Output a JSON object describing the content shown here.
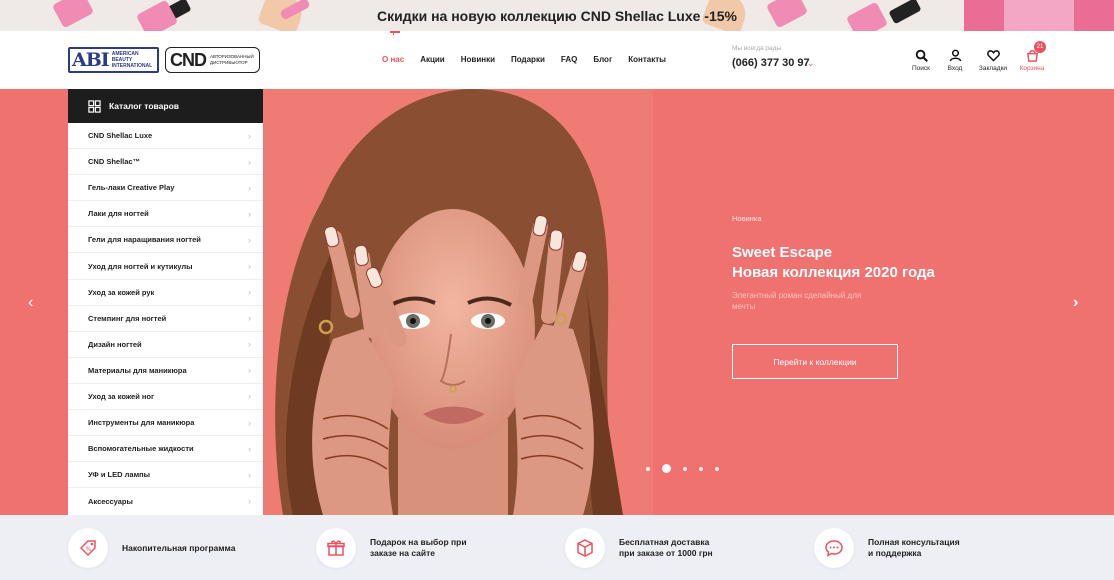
{
  "promo": {
    "text": "Скидки на новую коллекцию CND Shellac Luxe -15%"
  },
  "header": {
    "logo_abi": {
      "mark": "ABI",
      "words": "American Beauty International"
    },
    "logo_cnd": {
      "mark": "CND",
      "words": "Авторизованный дистрибьютор"
    },
    "nav": [
      {
        "label": "О нас",
        "active": true
      },
      {
        "label": "Акции"
      },
      {
        "label": "Новинки"
      },
      {
        "label": "Подарки"
      },
      {
        "label": "FAQ"
      },
      {
        "label": "Блог"
      },
      {
        "label": "Контакты"
      }
    ],
    "phone_note": "Мы всегда рады",
    "phone": "(066) 377 30 97",
    "icons": {
      "search": "Поиск",
      "login": "Вход",
      "bookmarks": "Закладки",
      "cart": "Корзина",
      "cart_count": "21"
    }
  },
  "catalog": {
    "title": "Каталог товаров",
    "items": [
      "CND Shellac Luxe",
      "CND Shellac™",
      "Гель-лаки Creative Play",
      "Лаки для ногтей",
      "Гели для наращивания ногтей",
      "Уход для ногтей и кутикулы",
      "Уход за кожей рук",
      "Стемпинг для ногтей",
      "Дизайн ногтей",
      "Материалы для маникюра",
      "Уход за кожей ног",
      "Инструменты для маникюра",
      "Вспомогательные жидкости",
      "УФ и LED лампы",
      "Аксессуары"
    ]
  },
  "slide": {
    "tag": "Новинка",
    "title_line1": "Sweet Escape",
    "title_line2": "Новая коллекция 2020 года",
    "subtitle": "Элегантный роман сделайный для мечты",
    "button": "Перейти к коллекции",
    "dots": 5,
    "active_dot": 2
  },
  "features": [
    {
      "text": "Накопительная программа"
    },
    {
      "text": "Подарок на выбор при\nзаказе на сайте"
    },
    {
      "text": "Бесплатная доставка\nпри заказе от 1000 грн"
    },
    {
      "text": "Полная консультация\nи поддержка"
    }
  ],
  "colors": {
    "accent": "#ea5460",
    "hero_bg": "#ef7170",
    "dark": "#1d1d1d",
    "features_bg": "#eeeef5"
  }
}
